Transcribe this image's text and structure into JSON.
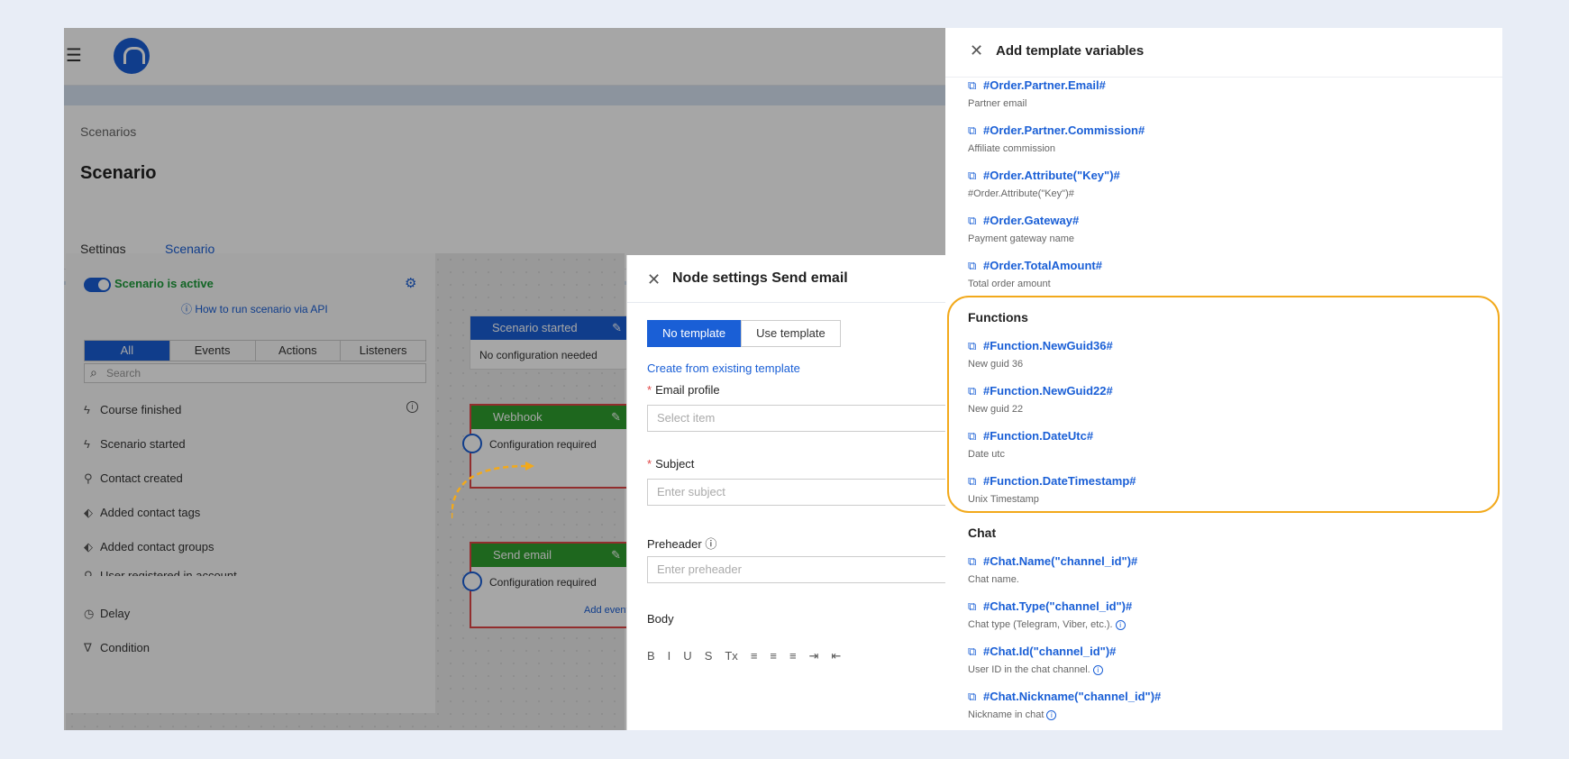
{
  "header": {
    "breadcrumb": "Scenarios",
    "title": "Scenario"
  },
  "tabs": [
    "Settings",
    "Scenario"
  ],
  "active_tab": "Scenario",
  "palette": {
    "active_label": "Scenario is active",
    "api_link": "How to run scenario via API",
    "filters": [
      "All",
      "Events",
      "Actions",
      "Listeners"
    ],
    "search_placeholder": "Search",
    "items": [
      "Course finished",
      "Scenario started",
      "Contact created",
      "Added contact tags",
      "Added contact groups",
      "User registered in account",
      "Delay",
      "Condition"
    ]
  },
  "nodes": {
    "scenario_started": {
      "title": "Scenario started",
      "body": "No configuration needed"
    },
    "webhook": {
      "title": "Webhook",
      "body": "Configuration required"
    },
    "send_email": {
      "title": "Send email",
      "body": "Configuration required",
      "link": "Add event"
    }
  },
  "node_settings": {
    "title": "Node settings Send email",
    "tpl_no": "No template",
    "tpl_use": "Use template",
    "create_link": "Create from existing template",
    "email_profile_label": "Email profile",
    "email_profile_placeholder": "Select item",
    "subject_label": "Subject",
    "subject_placeholder": "Enter subject",
    "preheader_label": "Preheader",
    "preheader_placeholder": "Enter preheader",
    "body_label": "Body",
    "toolbar": [
      "B",
      "I",
      "U",
      "S",
      "Tx",
      "≡",
      "≡",
      "≡",
      "⇥",
      "⇤"
    ]
  },
  "variables_drawer": {
    "title": "Add template variables",
    "order_vars": [
      {
        "name": "#Order.Partner.Email#",
        "desc": "Partner email"
      },
      {
        "name": "#Order.Partner.Commission#",
        "desc": "Affiliate commission"
      },
      {
        "name": "#Order.Attribute(\"Key\")#",
        "desc": "#Order.Attribute(\"Key\")#"
      },
      {
        "name": "#Order.Gateway#",
        "desc": "Payment gateway name"
      },
      {
        "name": "#Order.TotalAmount#",
        "desc": "Total order amount"
      }
    ],
    "functions_title": "Functions",
    "function_vars": [
      {
        "name": "#Function.NewGuid36#",
        "desc": "New guid 36"
      },
      {
        "name": "#Function.NewGuid22#",
        "desc": "New guid 22"
      },
      {
        "name": "#Function.DateUtc#",
        "desc": "Date utc"
      },
      {
        "name": "#Function.DateTimestamp#",
        "desc": "Unix Timestamp"
      }
    ],
    "chat_title": "Chat",
    "chat_vars": [
      {
        "name": "#Chat.Name(\"channel_id\")#",
        "desc": "Chat name."
      },
      {
        "name": "#Chat.Type(\"channel_id\")#",
        "desc": "Chat type (Telegram, Viber, etc.)."
      },
      {
        "name": "#Chat.Id(\"channel_id\")#",
        "desc": "User ID in the chat channel."
      },
      {
        "name": "#Chat.Nickname(\"channel_id\")#",
        "desc": "Nickname in chat"
      }
    ]
  },
  "colors": {
    "accent": "#1a5fd6",
    "highlight": "#f2a91b",
    "error": "#e14545",
    "webhook": "#2e9e2e",
    "scenario": "#1a5fd6"
  }
}
